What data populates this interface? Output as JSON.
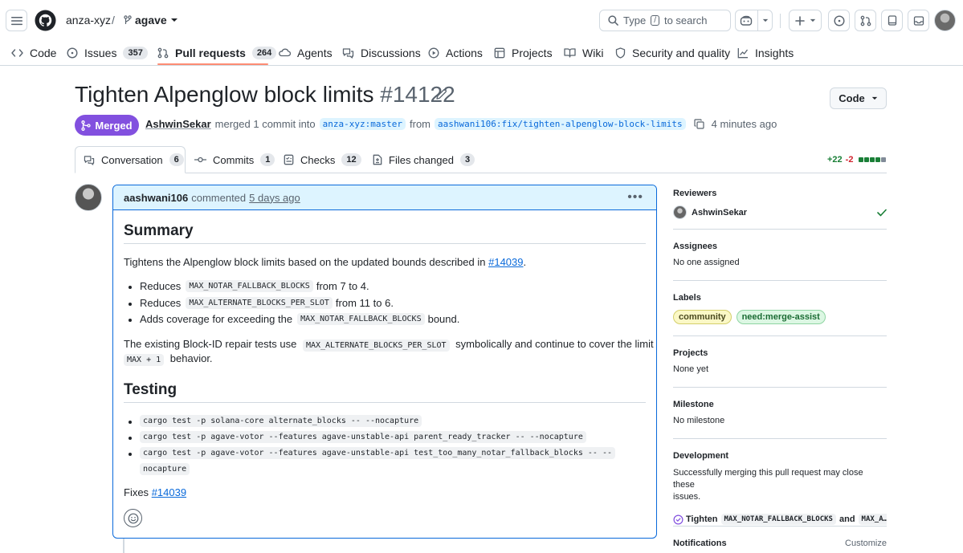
{
  "header": {
    "org": "anza-xyz",
    "separator": "/",
    "repo": "agave",
    "search_type": "Type",
    "search_key": "/",
    "search_suffix": "to search"
  },
  "repo_nav": [
    {
      "label": "Code",
      "icon": "code-icon",
      "count": ""
    },
    {
      "label": "Issues",
      "icon": "issue-opened-icon",
      "count": "357"
    },
    {
      "label": "Pull requests",
      "icon": "git-pull-request-icon",
      "count": "264"
    },
    {
      "label": "Agents",
      "icon": "agent-icon",
      "count": ""
    },
    {
      "label": "Discussions",
      "icon": "comment-discussion-icon",
      "count": ""
    },
    {
      "label": "Actions",
      "icon": "play-icon",
      "count": ""
    },
    {
      "label": "Projects",
      "icon": "table-icon",
      "count": ""
    },
    {
      "label": "Wiki",
      "icon": "book-icon",
      "count": ""
    },
    {
      "label": "Security and quality",
      "icon": "shield-icon",
      "count": ""
    },
    {
      "label": "Insights",
      "icon": "graph-icon",
      "count": ""
    }
  ],
  "pr": {
    "title": "Tighten Alpenglow block limits",
    "number": "#14122",
    "code_button": "Code",
    "state": "Merged",
    "merger": "AshwinSekar",
    "action": "merged 1 commit into",
    "base": "anza-xyz:master",
    "from": "from",
    "head": "aashwani106:fix/tighten-alpenglow-block-limits",
    "time": "4 minutes ago"
  },
  "tabs": [
    {
      "label": "Conversation",
      "count": "6"
    },
    {
      "label": "Commits",
      "count": "1"
    },
    {
      "label": "Checks",
      "count": "12"
    },
    {
      "label": "Files changed",
      "count": "3"
    }
  ],
  "diffstat": {
    "additions": "+22",
    "deletions": "-2"
  },
  "comment": {
    "author": "aashwani106",
    "verb": "commented",
    "time": "5 days ago",
    "summary_heading": "Summary",
    "summary_prefix": "Tightens the Alpenglow block limits based on the updated bounds described in",
    "summary_link": "#14039",
    "summary_suffix": ".",
    "bullets": [
      {
        "pre": "Reduces",
        "code": "MAX_NOTAR_FALLBACK_BLOCKS",
        "post": "from 7 to 4."
      },
      {
        "pre": "Reduces",
        "code": "MAX_ALTERNATE_BLOCKS_PER_SLOT",
        "post": "from 11 to 6."
      },
      {
        "pre": "Adds coverage for exceeding the",
        "code": "MAX_NOTAR_FALLBACK_BLOCKS",
        "post": "bound."
      }
    ],
    "para2_pre": "The existing Block-ID repair tests use",
    "para2_code": "MAX_ALTERNATE_BLOCKS_PER_SLOT",
    "para2_post": "symbolically and continue to cover the limit and",
    "para2_code2": "MAX + 1",
    "para2_end": "behavior.",
    "testing_heading": "Testing",
    "test_commands": [
      "cargo test -p solana-core alternate_blocks -- --nocapture",
      "cargo test -p agave-votor --features agave-unstable-api parent_ready_tracker -- --nocapture",
      "cargo test -p agave-votor --features agave-unstable-api test_too_many_notar_fallback_blocks -- --",
      "nocapture"
    ],
    "fixes_label": "Fixes",
    "fixes_link": "#14039"
  },
  "sidebar": {
    "reviewers_heading": "Reviewers",
    "reviewer": "AshwinSekar",
    "assignees_heading": "Assignees",
    "assignees_value": "No one assigned",
    "labels_heading": "Labels",
    "labels": [
      {
        "name": "community",
        "bg": "#fbf8c6",
        "fg": "#4b4a1f",
        "border": "#d4cf6b"
      },
      {
        "name": "need:merge-assist",
        "bg": "#dcf7e3",
        "fg": "#1a6b33",
        "border": "#8fd5a2"
      }
    ],
    "projects_heading": "Projects",
    "projects_value": "None yet",
    "milestone_heading": "Milestone",
    "milestone_value": "No milestone",
    "development_heading": "Development",
    "development_text_1": "Successfully merging this pull request may close these",
    "development_text_2": "issues.",
    "linked_issue_prefix": "Tighten",
    "linked_issue_code": "MAX_NOTAR_FALLBACK_BLOCKS",
    "linked_issue_and": "and",
    "linked_issue_code2": "MAX_A…",
    "notifications_heading": "Notifications",
    "customize": "Customize"
  },
  "colors": {
    "merged": "#8250df",
    "link": "#0969da",
    "accent_underline": "#fd8c73",
    "diff_add": "#1a7f37",
    "diff_del": "#d1242f"
  }
}
